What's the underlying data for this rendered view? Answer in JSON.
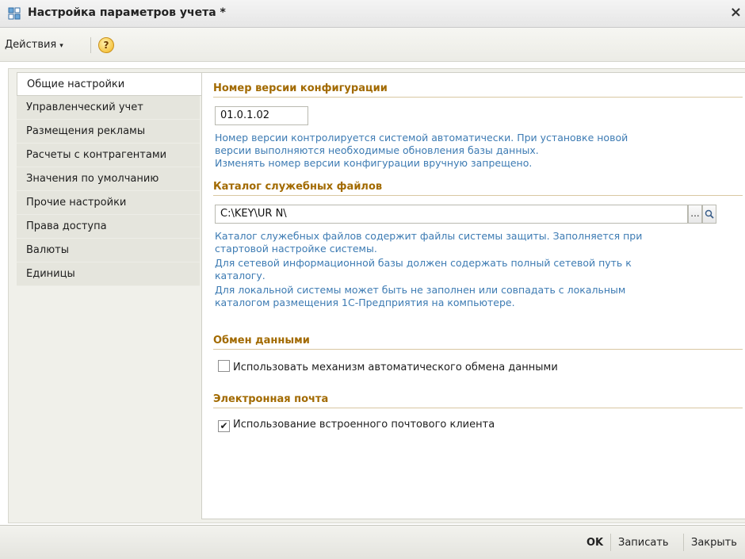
{
  "window": {
    "title": "Настройка параметров учета *",
    "close_glyph": "×",
    "app_icon": "settings-form-icon"
  },
  "toolbar": {
    "actions_label": "Действия",
    "actions_caret": "▾",
    "help_glyph": "?",
    "help_icon": "help-icon"
  },
  "sidebar": {
    "items": [
      {
        "label": "Общие настройки",
        "active": true
      },
      {
        "label": "Управленческий учет"
      },
      {
        "label": "Размещения рекламы"
      },
      {
        "label": "Расчеты с контрагентами"
      },
      {
        "label": "Значения по умолчанию"
      },
      {
        "label": "Прочие настройки"
      },
      {
        "label": "Права доступа"
      },
      {
        "label": "Валюты"
      },
      {
        "label": "Единицы"
      }
    ]
  },
  "sections": {
    "version": {
      "heading": "Номер версии конфигурации",
      "value": "01.0.1.02",
      "hints": [
        "Номер версии контролируется системой автоматически. При установке новой",
        "версии выполняются необходимые обновления базы данных.",
        "Изменять номер версии конфигурации вручную запрещено."
      ]
    },
    "catalog": {
      "heading": "Каталог служебных файлов",
      "value": "C:\\KEY\\UR N\\",
      "browse_glyph": "...",
      "search_icon": "magnifier-icon",
      "hints": [
        "Каталог служебных файлов содержит файлы системы защиты. Заполняется при",
        "стартовой настройке системы.",
        "Для сетевой информационной базы должен содержать полный сетевой путь к",
        "каталогу.",
        "Для локальной системы может быть не заполнен или совпадать с локальным",
        "каталогом размещения 1С-Предприятия на компьютере."
      ]
    },
    "exchange": {
      "heading": "Обмен данными",
      "checkbox_label": "Использовать механизм автоматического обмена данными",
      "checked": false
    },
    "email": {
      "heading": "Электронная почта",
      "checkbox_label": "Использование встроенного почтового клиента",
      "checked": true,
      "check_glyph": "✔"
    }
  },
  "footer": {
    "ok_label": "OK",
    "save_label": "Записать",
    "close_label": "Закрыть"
  },
  "colors": {
    "section_heading": "#a26a00",
    "hint_text": "#3d7bb3"
  }
}
